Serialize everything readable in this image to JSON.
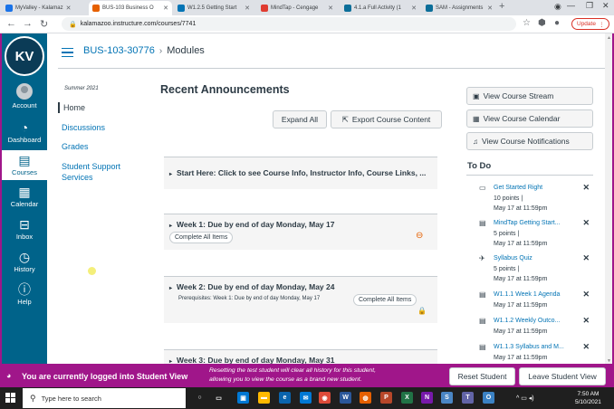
{
  "browser": {
    "tabs": [
      {
        "label": "MyValley - Kalamaz",
        "color": "#1a73e8"
      },
      {
        "label": "BUS-103 Business O",
        "color": "#e66000",
        "active": true
      },
      {
        "label": "W1.2.5 Getting Start",
        "color": "#0374b5"
      },
      {
        "label": "MindTap - Cengage",
        "color": "#e03c31"
      },
      {
        "label": "4.1.a Full Activity (1",
        "color": "#0b6e99"
      },
      {
        "label": "SAM - Assignments",
        "color": "#0b6e99"
      }
    ],
    "new_tab": "+",
    "url": "kalamazoo.instructure.com/courses/7741",
    "update_label": "Update"
  },
  "global_nav": {
    "logo_text": "KV",
    "items": [
      {
        "label": "Account",
        "icon": "user-icon"
      },
      {
        "label": "Dashboard",
        "icon": "dashboard-icon"
      },
      {
        "label": "Courses",
        "icon": "book-icon",
        "active": true
      },
      {
        "label": "Calendar",
        "icon": "calendar-icon"
      },
      {
        "label": "Inbox",
        "icon": "inbox-icon"
      },
      {
        "label": "History",
        "icon": "clock-icon"
      },
      {
        "label": "Help",
        "icon": "help-icon"
      }
    ]
  },
  "header": {
    "course": "BUS-103-30776",
    "separator": "›",
    "page": "Modules"
  },
  "course_nav": {
    "term": "Summer 2021",
    "items": [
      "Home",
      "Discussions",
      "Grades",
      "Student Support",
      "Services"
    ]
  },
  "main": {
    "title": "Recent Announcements",
    "expand_all": "Expand All",
    "export": "Export Course Content",
    "modules": [
      {
        "title": "Start Here: Click to see Course Info, Instructor Info, Course Links, ..."
      },
      {
        "title": "Week 1: Due by end of day Monday, May 17",
        "pill": "Complete All Items"
      },
      {
        "title": "Week 2: Due by end of day Monday, May 24",
        "prereq": "Prerequisites: Week 1: Due by end of day Monday, May 17",
        "pill": "Complete All Items"
      },
      {
        "title": "Week 3: Due by end of day Monday, May 31"
      }
    ]
  },
  "sidebar": {
    "buttons": [
      "View Course Stream",
      "View Course Calendar",
      "View Course Notifications"
    ],
    "todo_title": "To Do",
    "todos": [
      {
        "name": "Get Started Right",
        "points": "10 points  |",
        "due": "May 17 at 11:59pm",
        "icon": "discussion-icon"
      },
      {
        "name": "MindTap Getting Start...",
        "points": "5 points  |",
        "due": "May 17 at 11:59pm",
        "icon": "assignment-icon"
      },
      {
        "name": "Syllabus Quiz",
        "points": "5 points  |",
        "due": "May 17 at 11:59pm",
        "icon": "quiz-icon"
      },
      {
        "name": "W1.1.1 Week 1 Agenda",
        "points": "",
        "due": "May 17 at 11:59pm",
        "icon": "assignment-icon"
      },
      {
        "name": "W1.1.2 Weekly Outco...",
        "points": "",
        "due": "May 17 at 11:59pm",
        "icon": "assignment-icon"
      },
      {
        "name": "W1.1.3 Syllabus and M...",
        "points": "",
        "due": "May 17 at 11:59pm",
        "icon": "assignment-icon"
      }
    ],
    "dismiss": "✕"
  },
  "student_view": {
    "message": "You are currently logged into Student View",
    "note_line1": "Resetting the test student will clear all history for this student,",
    "note_line2": "allowing you to view the course as a brand new student.",
    "reset": "Reset Student",
    "leave": "Leave Student View"
  },
  "taskbar": {
    "search_placeholder": "Type here to search",
    "time": "7:50 AM",
    "date": "5/10/2021"
  }
}
